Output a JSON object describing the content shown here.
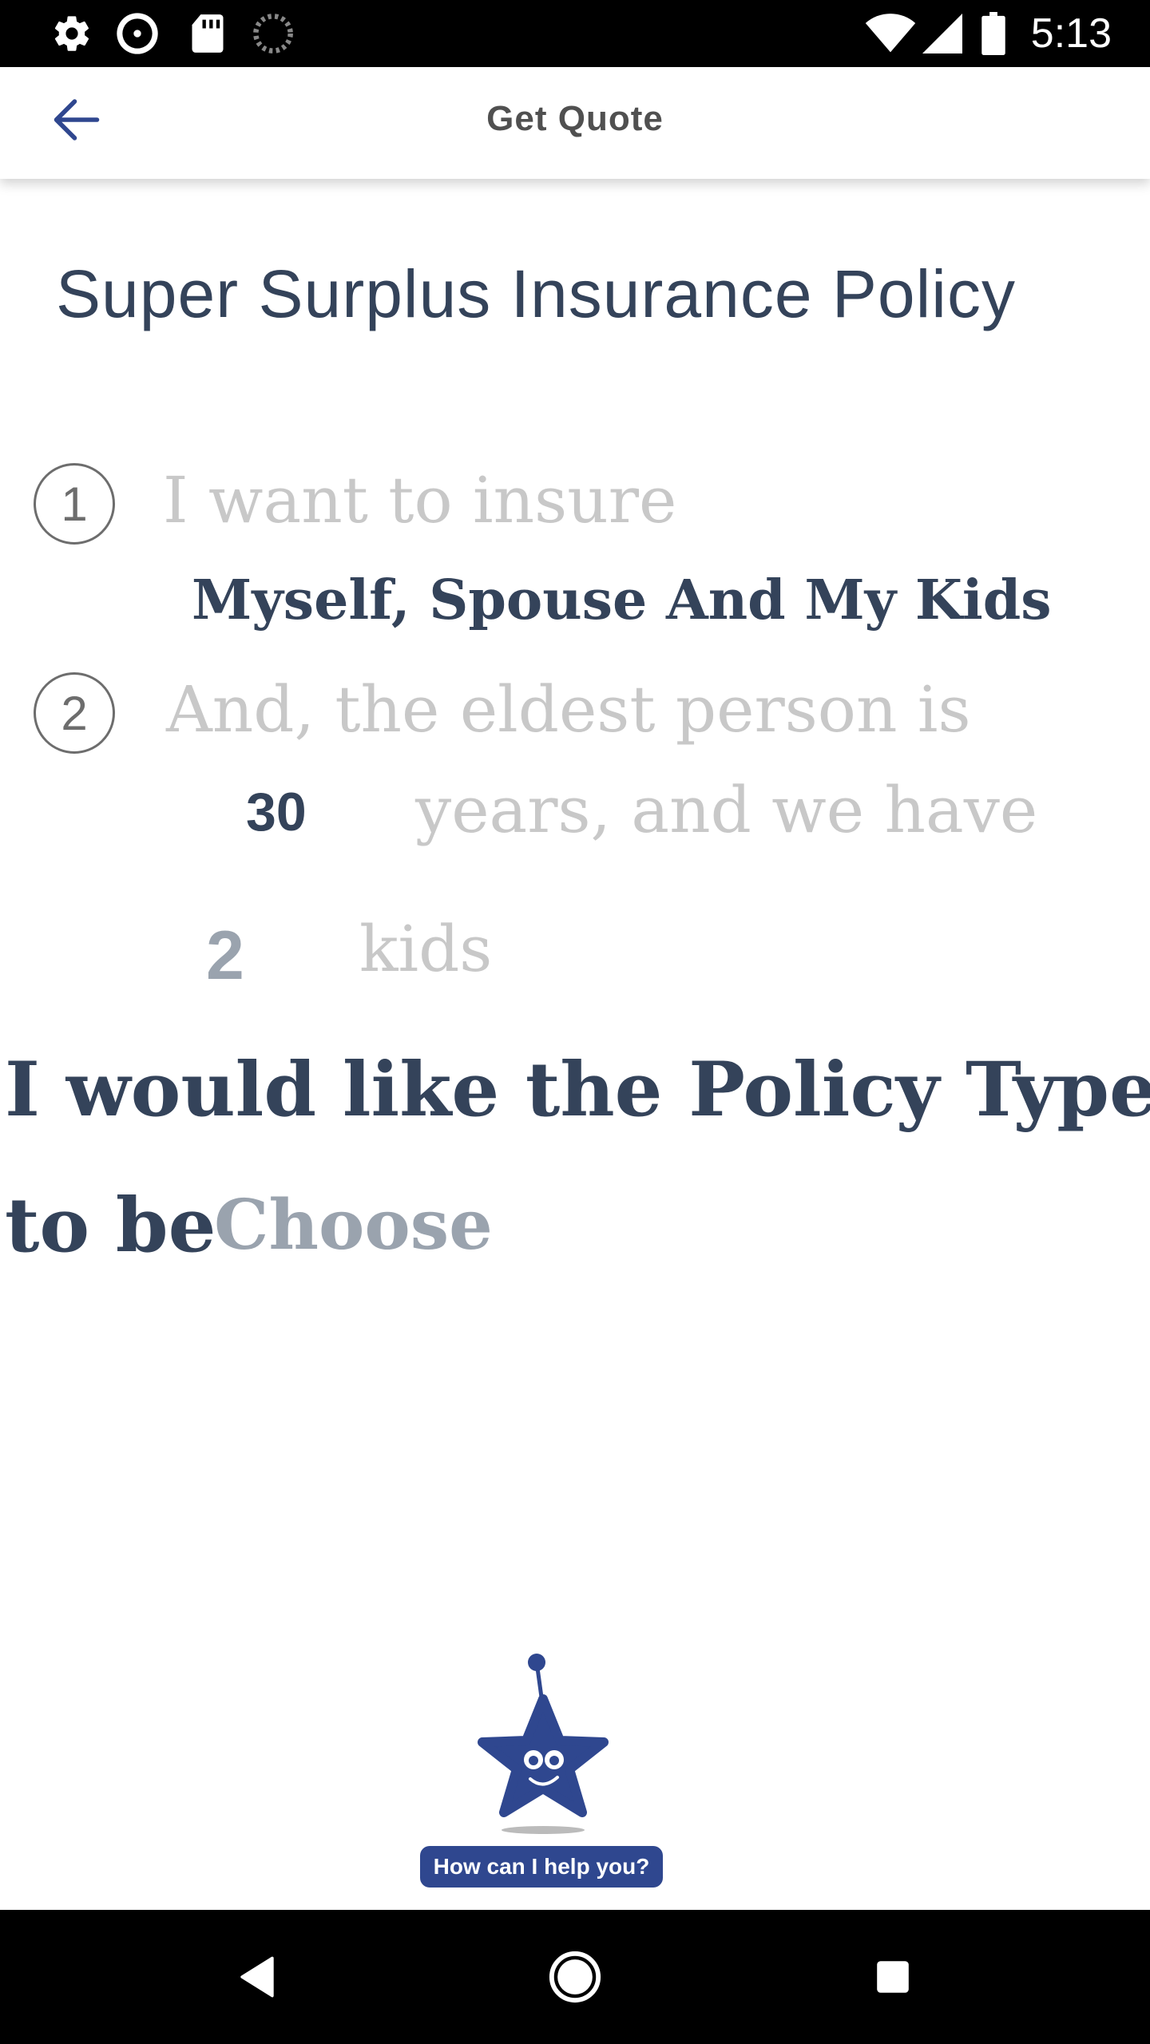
{
  "status_bar": {
    "time": "5:13",
    "icons": [
      "gear-icon",
      "camera-shutter-icon",
      "sd-card-icon",
      "spinner-icon",
      "wifi-icon",
      "signal-icon",
      "battery-icon"
    ]
  },
  "app_bar": {
    "title": "Get Quote",
    "back_icon": "arrow-left-icon"
  },
  "main": {
    "policy_title": "Super Surplus Insurance Policy",
    "step1": {
      "number": "1",
      "prompt": "I want to insure",
      "value": "Myself, Spouse And My Kids"
    },
    "step2": {
      "number": "2",
      "prompt": "And, the eldest person is",
      "age_value": "30",
      "age_suffix": "years, and we have",
      "kids_value": "2",
      "kids_suffix": "kids"
    },
    "policy_type": {
      "line1": "I would like the Policy Type",
      "line2": "to be",
      "choose_label": "Choose"
    }
  },
  "assistant": {
    "help_label": "How can I help you?",
    "mascot_icon": "star-robot-mascot-icon"
  },
  "nav_bar": {
    "icons": [
      "back-triangle-icon",
      "home-circle-icon",
      "recents-square-icon"
    ]
  },
  "colors": {
    "accent": "#2f478f",
    "dark_text": "#34435a",
    "light_text": "#c8c8c8",
    "muted_value": "#9aa3ae"
  }
}
